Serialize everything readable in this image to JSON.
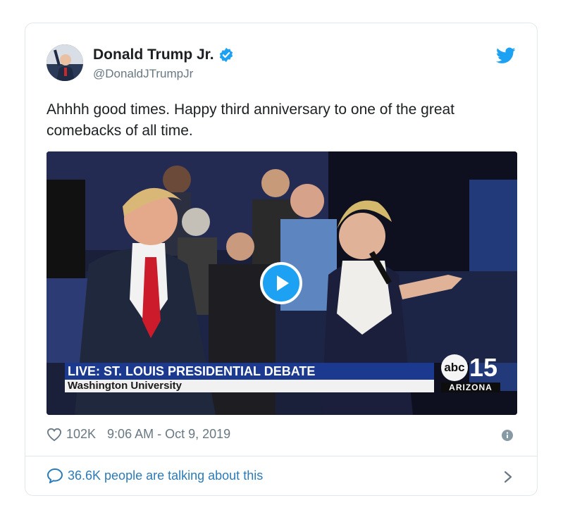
{
  "author": {
    "name": "Donald Trump Jr.",
    "handle": "@DonaldJTrumpJr",
    "avatar_icon": "profile-photo"
  },
  "tweet": {
    "text": "Ahhhh good times. Happy third anniversary to one of the great comebacks of all time."
  },
  "video": {
    "chyron_title": "LIVE: ST. LOUIS PRESIDENTIAL DEBATE",
    "chyron_subtitle": "Washington University",
    "logo_abc": "abc",
    "logo_number": "15",
    "logo_region": "ARIZONA"
  },
  "meta": {
    "likes": "102K",
    "timestamp": "9:06 AM - Oct 9, 2019"
  },
  "footer": {
    "talking": "36.6K people are talking about this"
  },
  "colors": {
    "twitter_blue": "#1da1f2",
    "link_blue": "#2b7bb9",
    "muted_gray": "#697882"
  }
}
